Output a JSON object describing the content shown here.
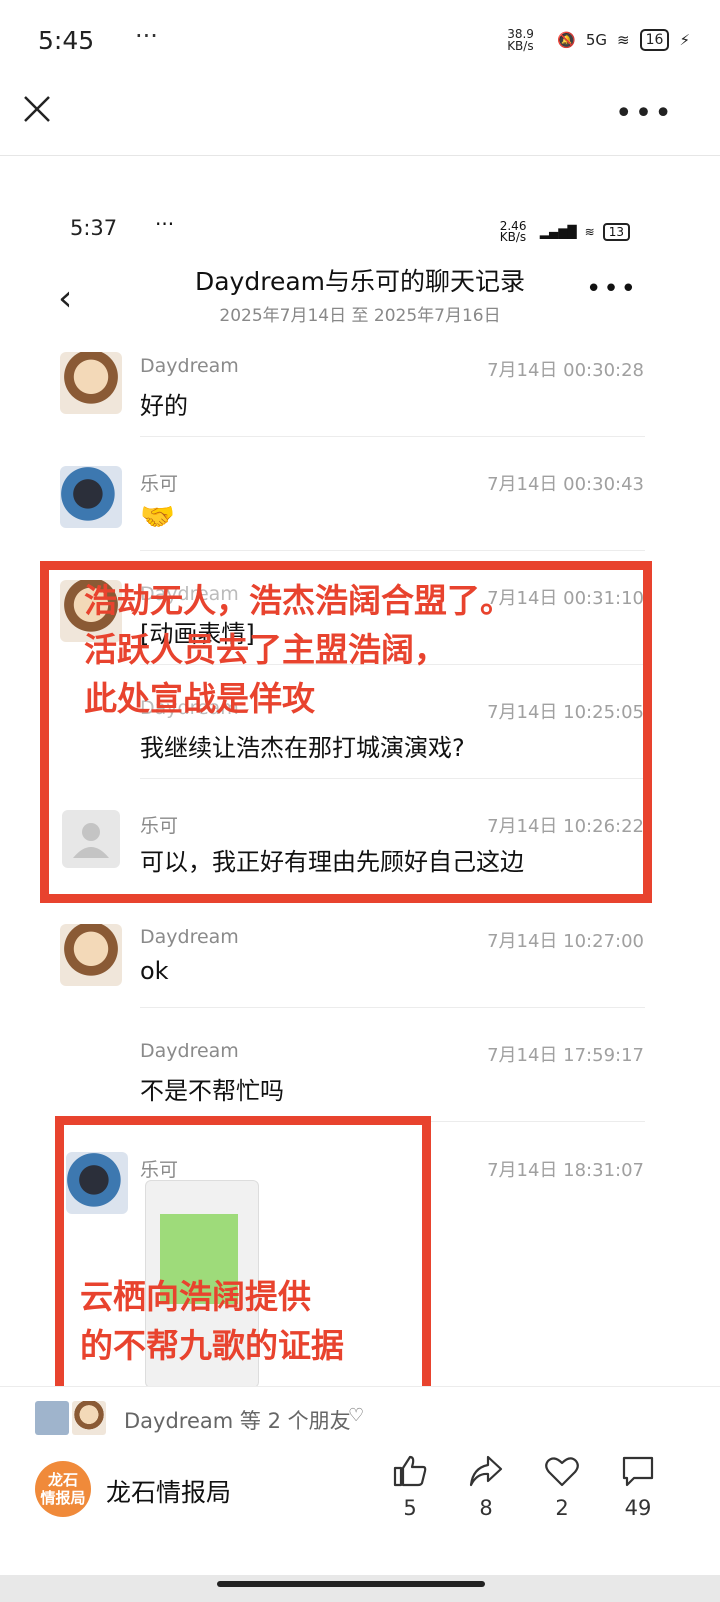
{
  "status": {
    "time": "5:45",
    "dots": "···",
    "net_speed": "38.9 KB/s",
    "battery": "16",
    "network": "5G"
  },
  "chat": {
    "status_time": "5:37",
    "status_dots": "···",
    "net_speed": "2.46 KB/s",
    "battery": "13",
    "title": "Daydream与乐可的聊天记录",
    "date_range": "2025年7月14日 至 2025年7月16日",
    "messages": [
      {
        "sender": "Daydream",
        "time": "7月14日 00:30:28",
        "text": "好的"
      },
      {
        "sender": "乐可",
        "time": "7月14日 00:30:43",
        "text": "🤝"
      },
      {
        "sender": "Daydream",
        "time": "7月14日 00:31:10",
        "text": "[动画表情]"
      },
      {
        "sender": "Daydream",
        "time": "7月14日 10:25:05",
        "text": "我继续让浩杰在那打城演演戏?"
      },
      {
        "sender": "乐可",
        "time": "7月14日 10:26:22",
        "text": "可以，我正好有理由先顾好自己这边"
      },
      {
        "sender": "Daydream",
        "time": "7月14日 10:27:00",
        "text": "ok"
      },
      {
        "sender": "Daydream",
        "time": "7月14日 17:59:17",
        "text": "不是不帮忙吗"
      },
      {
        "sender": "乐可",
        "time": "7月14日 18:31:07",
        "text": ""
      }
    ]
  },
  "annotations": {
    "box1": [
      "浩劫无人，浩杰浩阔合盟了。",
      "活跃人员去了主盟浩阔，",
      "此处宣战是佯攻"
    ],
    "box2": [
      "云栖向浩阔提供",
      "的不帮九歌的证据"
    ]
  },
  "footer": {
    "friends_text": "Daydream 等 2 个朋友",
    "account_name": "龙石情报局",
    "logo_text": "龙石\n情报局",
    "like_count": "5",
    "share_count": "8",
    "fav_count": "2",
    "comment_count": "49"
  },
  "colors": {
    "annotation_red": "#e8432e",
    "logo_orange": "#f08a3a"
  },
  "icons": [
    "close-icon",
    "more-icon",
    "back-icon",
    "like-icon",
    "share-icon",
    "heart-icon",
    "comment-icon"
  ]
}
